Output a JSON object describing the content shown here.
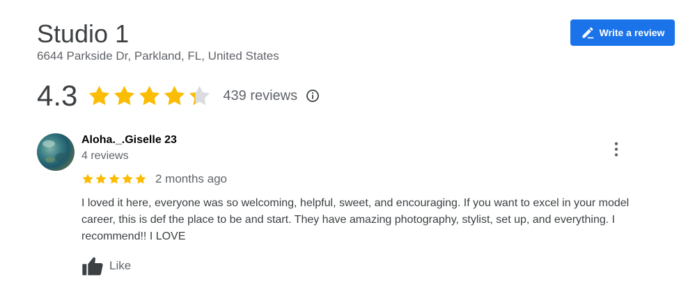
{
  "place": {
    "title": "Studio 1",
    "address": "6644 Parkside Dr, Parkland, FL, United States"
  },
  "actions": {
    "write_review_label": "Write a review",
    "write_review_icon": "pencil-icon"
  },
  "rating": {
    "value": "4.3",
    "stars_filled": 4.3,
    "stars_total": 5,
    "review_count_text": "439 reviews",
    "info_icon": "info-icon"
  },
  "review": {
    "author_name": "Aloha._.Giselle 23",
    "author_review_count": "4 reviews",
    "stars": 5,
    "date": "2 months ago",
    "text": "I loved it here, everyone was so welcoming, helpful, sweet, and encouraging. If you want to excel in your model career, this is def the place to be and start. They have amazing photography, stylist, set up, and everything. I recommend!! I LOVE",
    "like_label": "Like",
    "menu_icon": "more-vert-icon",
    "like_icon": "thumbs-up-icon"
  },
  "colors": {
    "accent": "#1a73e8",
    "star": "#fbbc04",
    "star_empty": "#dadce0",
    "text_secondary": "#5f6368"
  }
}
